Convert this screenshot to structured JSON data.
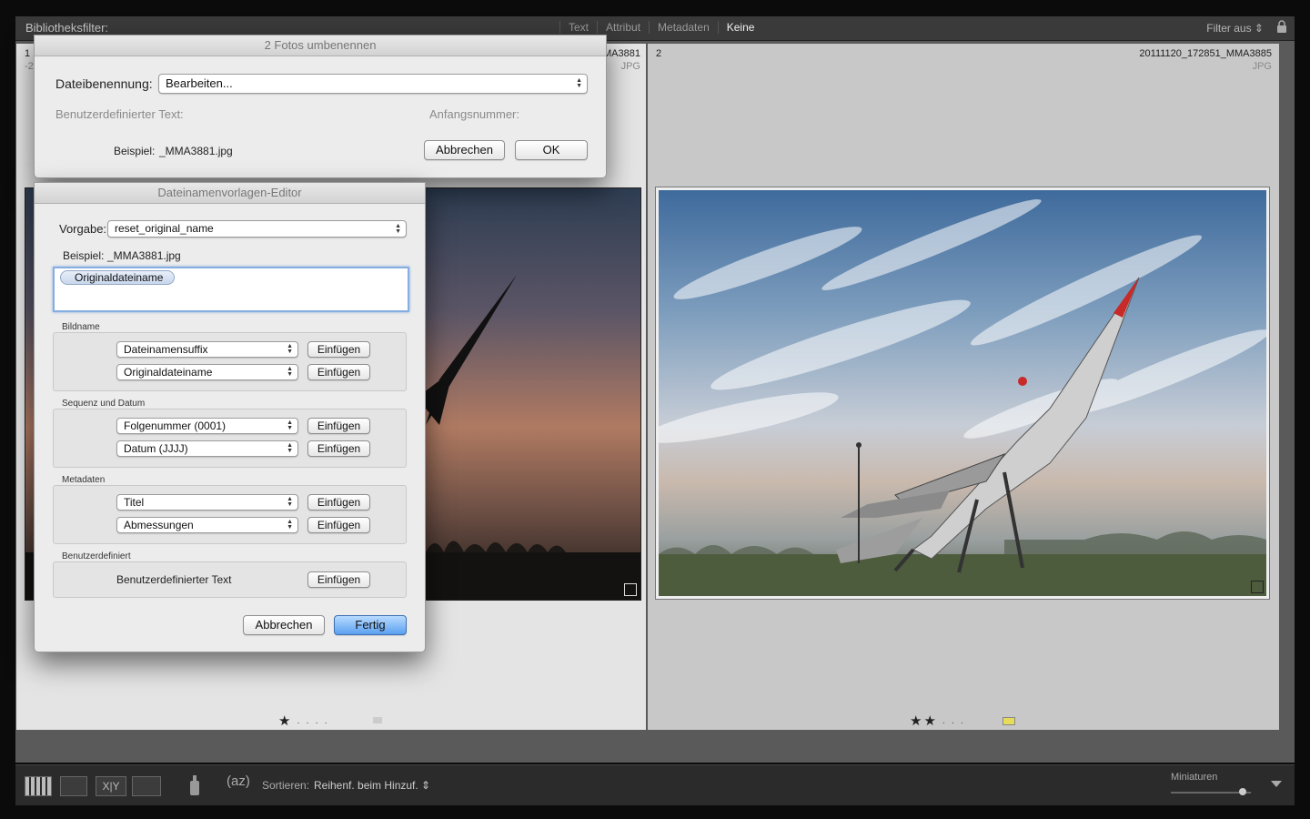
{
  "filterbar": {
    "title": "Bibliotheksfilter:",
    "tabs": [
      "Text",
      "Attribut",
      "Metadaten",
      "Keine"
    ],
    "active_tab": "Keine",
    "filter_status": "Filter aus ⇕"
  },
  "grid": {
    "cell1": {
      "number": "1",
      "number_sub": "-2",
      "filename": "MA3881",
      "filetype": "JPG",
      "rating": 1
    },
    "cell2": {
      "number": "2",
      "filename": "20111120_172851_MMA3885",
      "filetype": "JPG",
      "rating": 2,
      "color_label": "#e6dc5a"
    }
  },
  "toolbar": {
    "sort_label": "Sortieren:",
    "sort_value": "Reihenf. beim Hinzuf. ⇕",
    "thumbnails_label": "Miniaturen",
    "thumbnail_size_fraction": 0.9
  },
  "rename_dialog": {
    "title": "2 Fotos umbenennen",
    "naming_label": "Dateibenennung:",
    "naming_value": "Bearbeiten...",
    "custom_text_label": "Benutzerdefinierter Text:",
    "start_number_label": "Anfangsnummer:",
    "example_label": "Beispiel:",
    "example_value": "_MMA3881.jpg",
    "cancel": "Abbrechen",
    "ok": "OK"
  },
  "template_editor": {
    "title": "Dateinamenvorlagen-Editor",
    "preset_label": "Vorgabe:",
    "preset_value": "reset_original_name",
    "example_label": "Beispiel:",
    "example_value": "_MMA3881.jpg",
    "token": "Originaldateiname",
    "insert": "Einfügen",
    "groups": {
      "image_name": {
        "label": "Bildname",
        "rows": [
          "Dateinamensuffix",
          "Originaldateiname"
        ]
      },
      "sequence_date": {
        "label": "Sequenz und Datum",
        "rows": [
          "Folgenummer (0001)",
          "Datum (JJJJ)"
        ]
      },
      "metadata": {
        "label": "Metadaten",
        "rows": [
          "Titel",
          "Abmessungen"
        ]
      },
      "custom": {
        "label": "Benutzerdefiniert",
        "row_text": "Benutzerdefinierter Text"
      }
    },
    "cancel": "Abbrechen",
    "done": "Fertig"
  },
  "colors": {
    "accent": "#5a9ff0",
    "panel_dark": "#2b2b2b",
    "dialog_bg": "#ececec"
  }
}
